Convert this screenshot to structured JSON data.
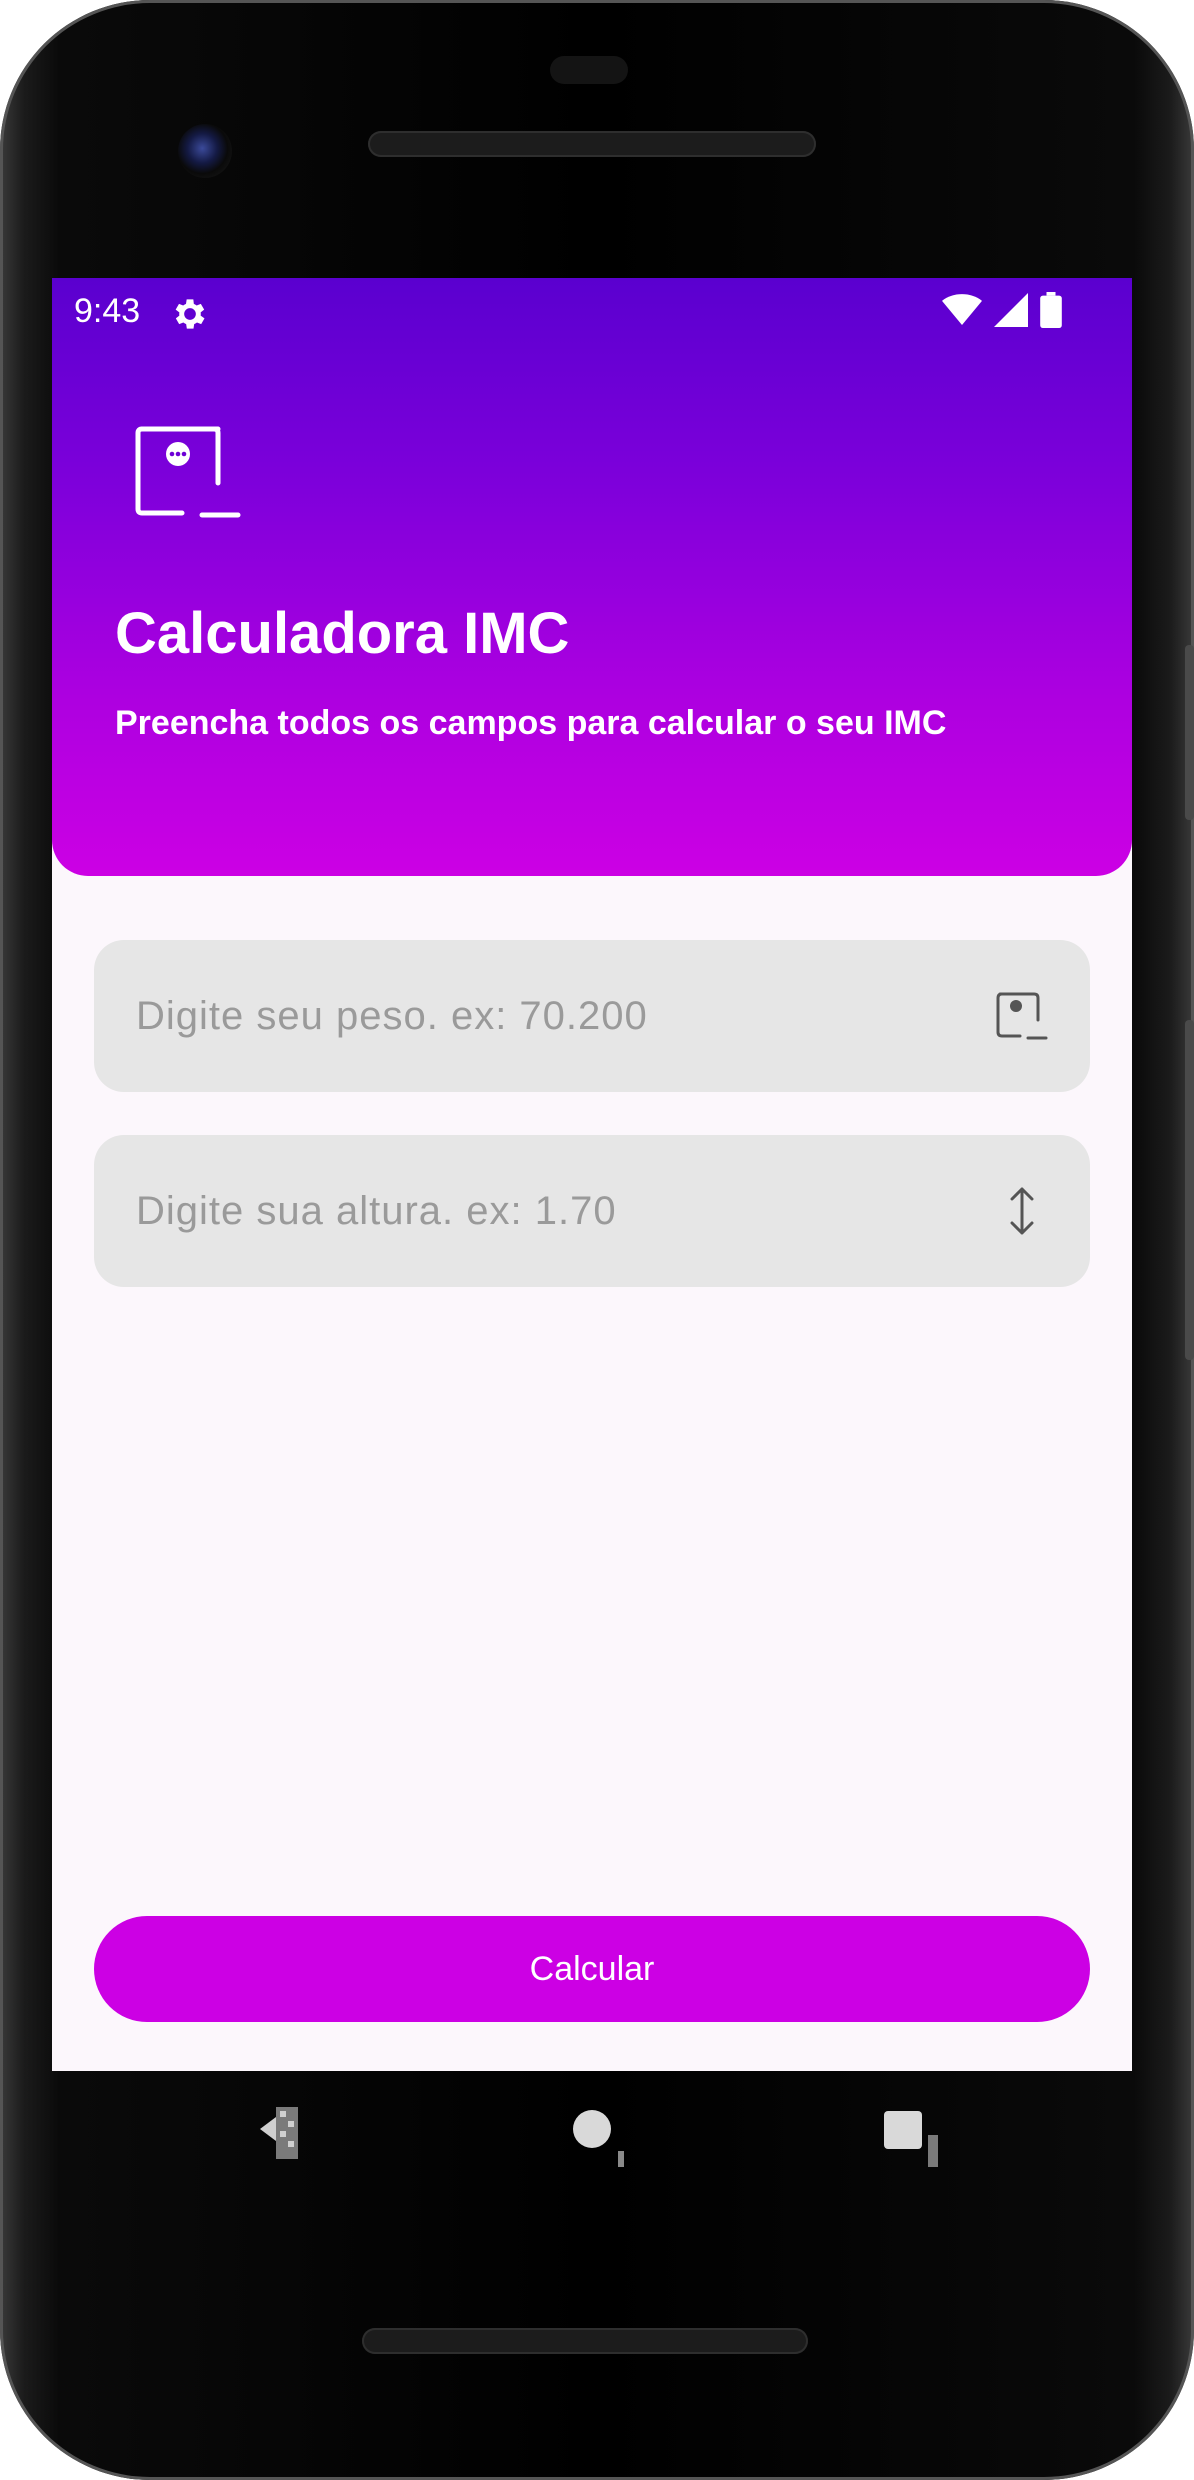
{
  "status": {
    "time": "9:43"
  },
  "header": {
    "title": "Calculadora IMC",
    "subtitle": "Preencha todos os campos para calcular o seu IMC"
  },
  "form": {
    "weight": {
      "placeholder": "Digite seu peso. ex: 70.200",
      "value": ""
    },
    "height": {
      "placeholder": "Digite sua altura. ex: 1.70",
      "value": ""
    }
  },
  "actions": {
    "calculate_label": "Calcular"
  },
  "icons": {
    "status": [
      "settings-gear-icon",
      "wifi-icon",
      "signal-icon",
      "battery-icon"
    ],
    "app": "weight-scale-icon",
    "weight_field": "weight-scale-icon",
    "height_field": "vertical-arrows-icon",
    "nav": [
      "back-icon",
      "home-icon",
      "recents-icon"
    ]
  },
  "colors": {
    "header_gradient_top": "#5a00cf",
    "header_gradient_bottom": "#cc00e4",
    "accent": "#cc00e4",
    "field_background": "#e6e6e6",
    "screen_background": "#fcf7fc"
  }
}
